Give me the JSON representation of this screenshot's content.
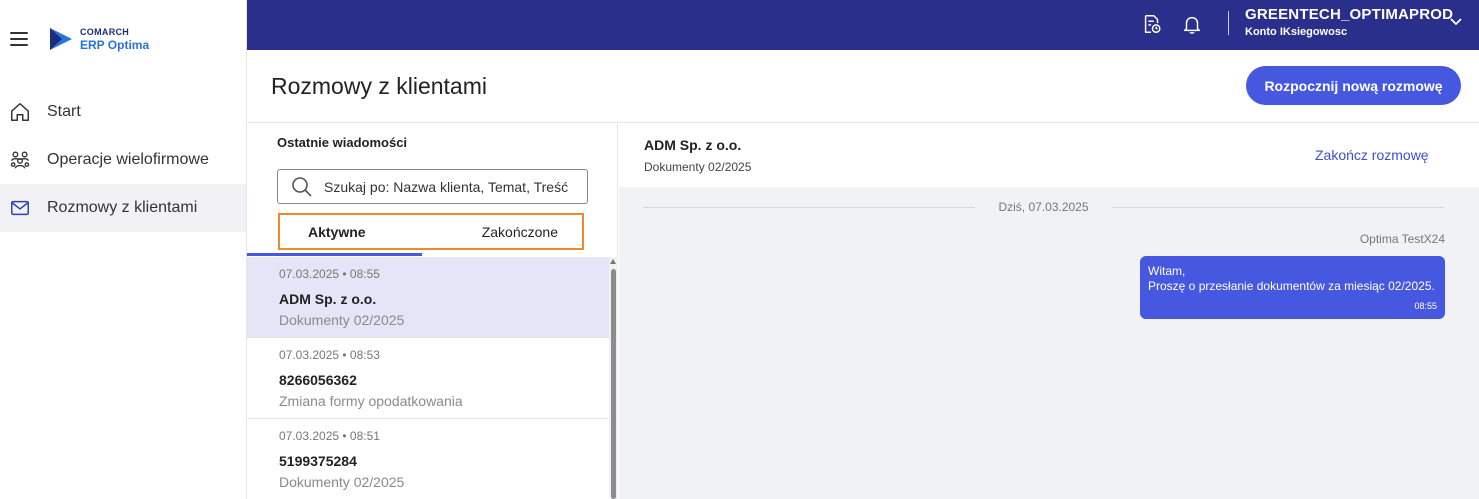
{
  "sidebar": {
    "logo_brand": "COMARCH",
    "logo_product": "ERP Optima",
    "items": [
      {
        "label": "Start",
        "icon": "home-icon"
      },
      {
        "label": "Operacje wielofirmowe",
        "icon": "users-group-icon"
      },
      {
        "label": "Rozmowy z klientami",
        "icon": "envelope-icon"
      }
    ]
  },
  "topbar": {
    "account_name": "GREENTECH_OPTIMAPROD",
    "account_sub": "Konto IKsiegowosc"
  },
  "header": {
    "title": "Rozmowy z klientami",
    "new_conversation_label": "Rozpocznij nową rozmowę"
  },
  "list": {
    "recent_label": "Ostatnie wiadomości",
    "search_placeholder": "Szukaj po: Nazwa klienta, Temat, Treść",
    "tabs": [
      "Aktywne",
      "Zakończone"
    ],
    "items": [
      {
        "date": "07.03.2025 • 08:55",
        "name": "ADM Sp. z o.o.",
        "topic": "Dokumenty 02/2025"
      },
      {
        "date": "07.03.2025 • 08:53",
        "name": "8266056362",
        "topic": "Zmiana formy opodatkowania"
      },
      {
        "date": "07.03.2025 • 08:51",
        "name": "5199375284",
        "topic": "Dokumenty 02/2025"
      }
    ]
  },
  "chat": {
    "name": "ADM Sp. z o.o.",
    "topic": "Dokumenty 02/2025",
    "end_label": "Zakończ rozmowę",
    "date_separator": "Dziś, 07.03.2025",
    "sender": "Optima TestX24",
    "message_line1": "Witam,",
    "message_line2": "Proszę o przesłanie dokumentów za miesiąc 02/2025.",
    "message_time": "08:55"
  },
  "colors": {
    "topbar": "#2a2f8c",
    "accent": "#4658e0",
    "selected_row": "#e4e5f6",
    "tab_highlight_border": "#f0892a"
  }
}
